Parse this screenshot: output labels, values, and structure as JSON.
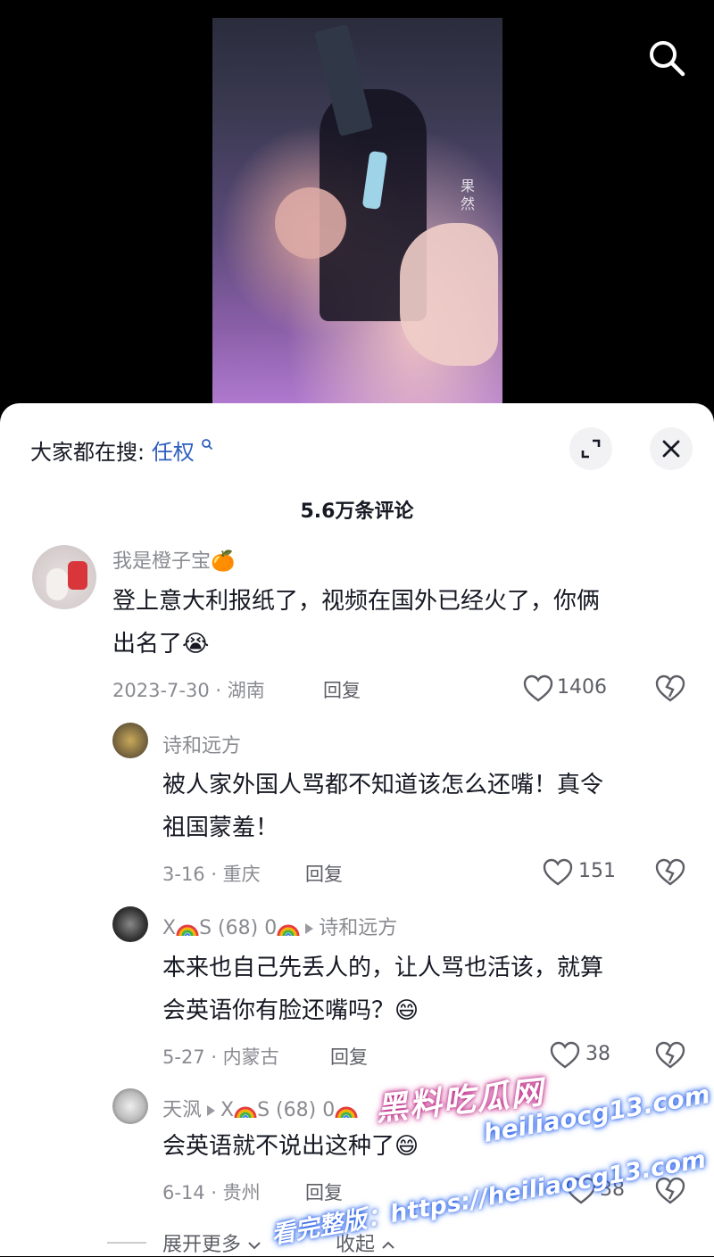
{
  "video": {
    "watermark": "果然"
  },
  "header": {
    "search_label": "大家都在搜: ",
    "search_keyword": "任权",
    "comment_count": "5.6万条评论"
  },
  "comments": [
    {
      "user": "我是橙子宝🍊",
      "text_line1": "登上意大利报纸了，视频在国外已经火了，你俩",
      "text_line2": "出名了😭",
      "date_loc": "2023-7-30 · 湖南",
      "reply": "回复",
      "likes": "1406"
    },
    {
      "user": "诗和远方",
      "text_line1": "被人家外国人骂都不知道该怎么还嘴！真令",
      "text_line2": "祖国蒙羞！",
      "date_loc": "3-16 · 重庆",
      "reply": "回复",
      "likes": "151"
    },
    {
      "user": "X",
      "user_mid": "S (68) 0",
      "reply_to": "诗和远方",
      "text_line1": "本来也自己先丢人的，让人骂也活该，就算",
      "text_line2": "会英语你有脸还嘴吗？😄",
      "date_loc": "5-27 · 内蒙古",
      "reply": "回复",
      "likes": "38"
    },
    {
      "user": "天沨",
      "reply_to_a": "X",
      "reply_to_b": "S (68) 0",
      "text_line1": "会英语就不说出这种了😄",
      "date_loc": "6-14 · 贵州",
      "reply": "回复",
      "likes": "38"
    }
  ],
  "footer": {
    "expand_more": "展开更多",
    "collapse": "收起"
  },
  "overlay": {
    "brand": "黑料吃瓜网",
    "url": "heiliaocg13.com",
    "line": "看完整版：https://heiliaocg13.com"
  }
}
